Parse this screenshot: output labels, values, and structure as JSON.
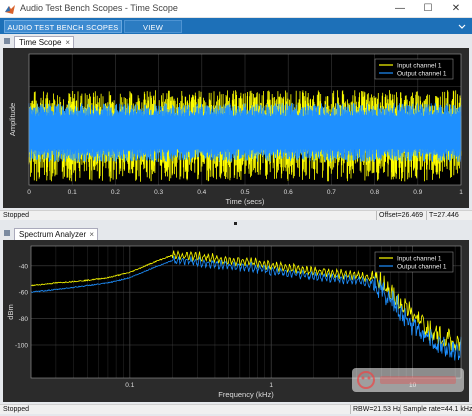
{
  "window": {
    "title": "Audio Test Bench Scopes - Time Scope",
    "minimize_glyph": "—",
    "maximize_glyph": "☐",
    "close_glyph": "✕",
    "app_icon": "matlab-logo-icon"
  },
  "toolstrip": {
    "tabs": [
      {
        "label": "AUDIO TEST BENCH SCOPES",
        "active": true
      },
      {
        "label": "VIEW",
        "active": false
      }
    ]
  },
  "time_scope": {
    "tab_label": "Time Scope",
    "close_glyph": "×",
    "status": {
      "left": "Stopped",
      "offset": "Offset=26.469",
      "time": "T=27.446"
    }
  },
  "spectrum_analyzer": {
    "tab_label": "Spectrum Analyzer",
    "close_glyph": "×",
    "status": {
      "left": "Stopped",
      "rbw": "RBW=21.53 Hz",
      "sample_rate": "Sample rate=44.1 kHz"
    }
  },
  "colors": {
    "input_channel": "#ffff00",
    "output_channel": "#1e90ff",
    "axes_background": "#000000",
    "panel_background": "#2b2b2b",
    "toolstrip": "#1d70b8"
  },
  "chart_data": [
    {
      "type": "line",
      "ylabel": "Amplitude",
      "xlabel": "Time (secs)",
      "xlim": [
        0,
        1
      ],
      "ylim": [
        -0.5,
        1.5
      ],
      "x_ticks": [
        "0",
        "0.1",
        "0.2",
        "0.3",
        "0.4",
        "0.5",
        "0.6",
        "0.7",
        "0.8",
        "0.9",
        "1"
      ],
      "grid": true,
      "legend_position": "top-right",
      "series": [
        {
          "name": "Input channel 1",
          "color": "#ffff00",
          "kind": "noise",
          "upper_band": [
            0.55,
            0.95
          ],
          "lower_band": [
            0.05,
            -0.45
          ]
        },
        {
          "name": "Output channel 1",
          "color": "#1e90ff",
          "kind": "noise",
          "upper_band": [
            0.55,
            0.75
          ],
          "lower_band": [
            0.05,
            -0.15
          ]
        }
      ]
    },
    {
      "type": "line",
      "ylabel": "dBm",
      "xlabel": "Frequency (kHz)",
      "x_scale": "log",
      "xlim": [
        0.02,
        22
      ],
      "ylim": [
        -125,
        -25
      ],
      "x_ticks": [
        "0.1",
        "1",
        "10"
      ],
      "y_ticks": [
        "-40",
        "-60",
        "-80",
        "-100"
      ],
      "grid": true,
      "legend_position": "top-right",
      "series": [
        {
          "name": "Input channel 1",
          "color": "#ffff00",
          "x": [
            0.02,
            0.03,
            0.05,
            0.07,
            0.1,
            0.15,
            0.2,
            0.3,
            0.5,
            0.7,
            1,
            1.5,
            2,
            3,
            4,
            5,
            6,
            7,
            8,
            10,
            13,
            16,
            20,
            22
          ],
          "y": [
            -55,
            -53,
            -51,
            -49,
            -45,
            -37,
            -32,
            -33,
            -36,
            -37,
            -40,
            -42,
            -44,
            -46,
            -47,
            -49,
            -52,
            -60,
            -67,
            -78,
            -88,
            -95,
            -98,
            -97
          ]
        },
        {
          "name": "Output channel 1",
          "color": "#1e90ff",
          "x": [
            0.02,
            0.03,
            0.05,
            0.07,
            0.1,
            0.15,
            0.2,
            0.3,
            0.5,
            0.7,
            1,
            1.5,
            2,
            3,
            4,
            5,
            6,
            7,
            8,
            10,
            13,
            16,
            20,
            22
          ],
          "y": [
            -60,
            -58,
            -55,
            -53,
            -49,
            -41,
            -36,
            -37,
            -40,
            -41,
            -44,
            -46,
            -48,
            -50,
            -51,
            -53,
            -57,
            -65,
            -73,
            -85,
            -95,
            -101,
            -104,
            -103
          ]
        }
      ]
    }
  ]
}
